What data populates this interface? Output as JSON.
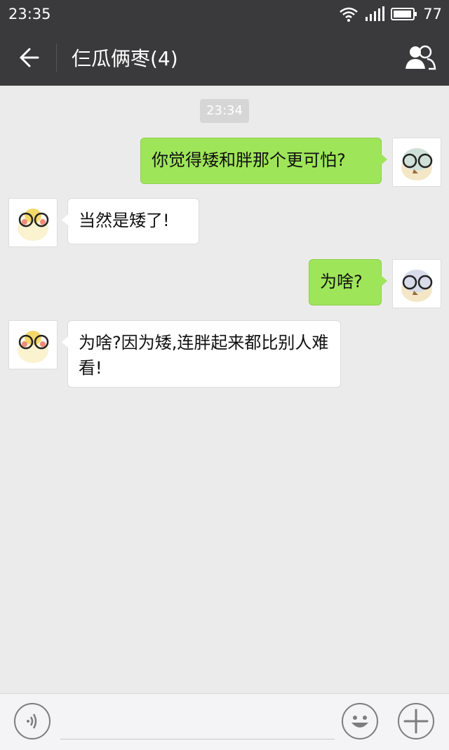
{
  "status_bar": {
    "time": "23:35",
    "battery": "77"
  },
  "header": {
    "title": "仨瓜俩枣(4)"
  },
  "chat": {
    "timestamp": "23:34",
    "messages": [
      {
        "direction": "out",
        "text": "你觉得矮和胖那个更可怕?"
      },
      {
        "direction": "in",
        "text": "当然是矮了!"
      },
      {
        "direction": "out",
        "text": "为啥?"
      },
      {
        "direction": "in",
        "text": "为啥?因为矮,连胖起来都比别人难看!"
      }
    ]
  },
  "input": {
    "value": "",
    "placeholder": ""
  },
  "icons": {
    "back": "back-arrow-icon",
    "members": "group-members-icon",
    "voice": "voice-icon",
    "emoji": "emoji-icon",
    "plus": "plus-icon"
  },
  "colors": {
    "bar": "#3a3a3c",
    "out_bubble": "#9fe559",
    "in_bubble": "#ffffff",
    "chat_bg": "#ebebeb"
  }
}
